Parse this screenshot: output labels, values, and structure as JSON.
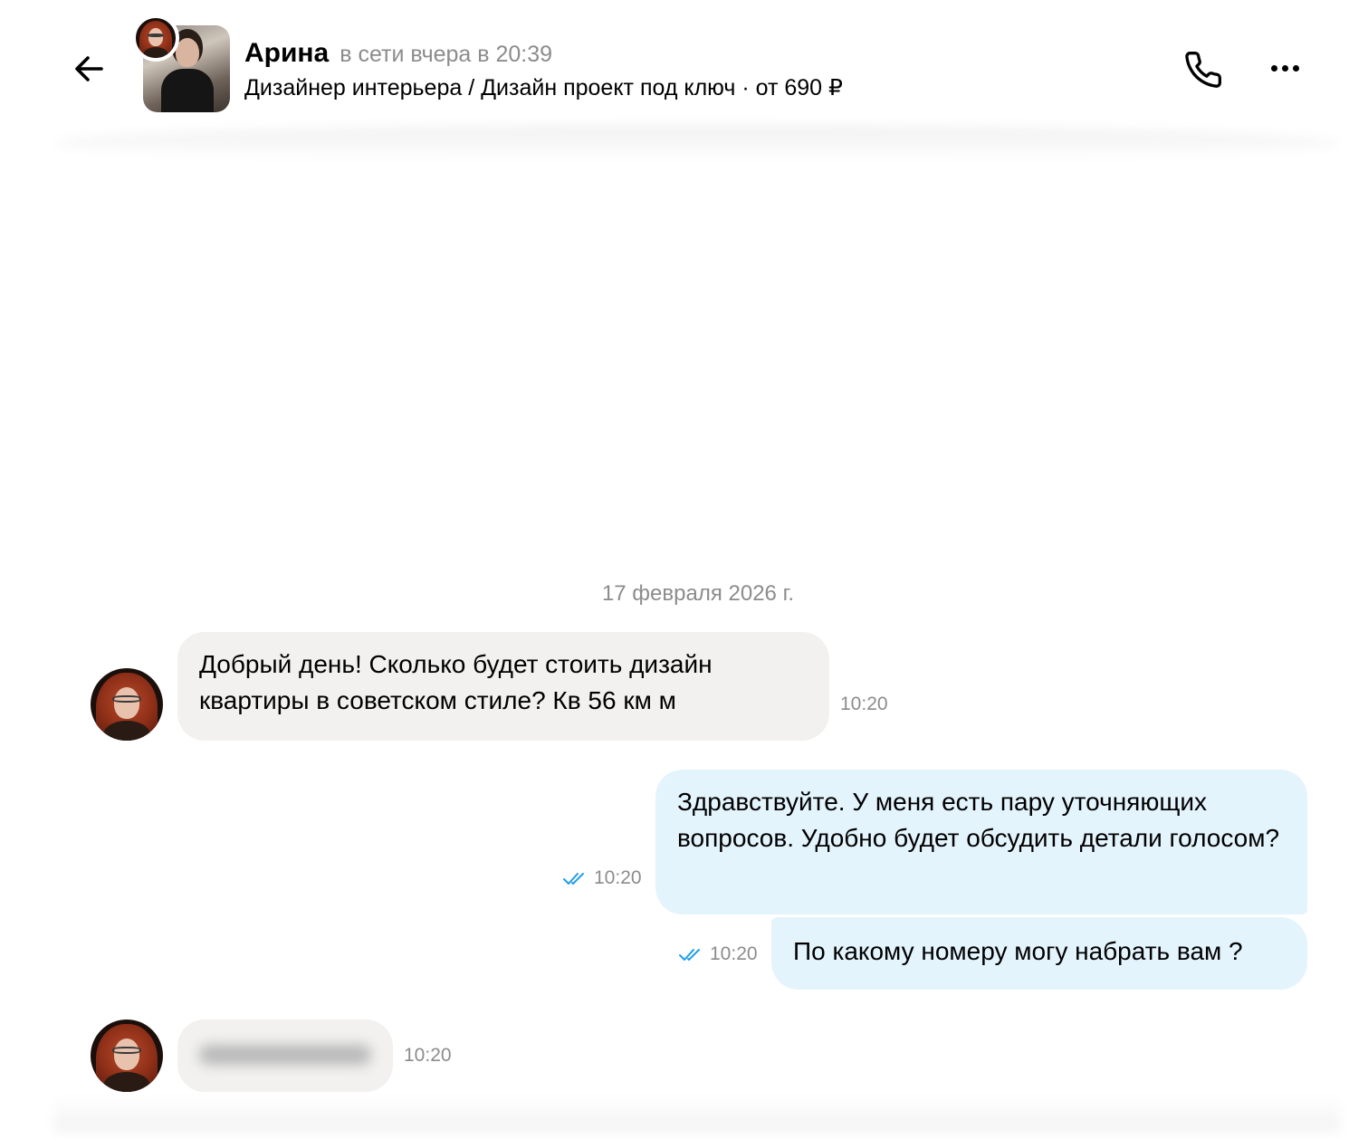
{
  "header": {
    "contact_name": "Арина",
    "contact_status": "в сети вчера в 20:39",
    "listing_title": "Дизайнер интерьера / Дизайн проект под ключ · от 690 ₽",
    "icons": {
      "back": "arrow-left-icon",
      "call": "phone-icon",
      "more": "more-dots-icon"
    }
  },
  "chat": {
    "date_separator": "17 февраля 2026 г.",
    "messages": [
      {
        "direction": "incoming",
        "text": "Добрый день! Сколько будет стоить дизайн квартиры в советском стиле? Кв 56 км м",
        "time": "10:20"
      },
      {
        "direction": "outgoing",
        "text": "Здравствуйте. У меня есть пару уточняющих вопросов. Удобно будет обсудить детали голосом?",
        "time": "10:20",
        "status": "read"
      },
      {
        "direction": "outgoing",
        "text": "По какому номеру могу набрать вам ?",
        "time": "10:20",
        "status": "read"
      },
      {
        "direction": "incoming",
        "text": "",
        "time": "10:20",
        "blurred": true
      }
    ]
  },
  "colors": {
    "incoming_bubble": "#f2f1f0",
    "outgoing_bubble": "#e4f4fd",
    "read_check": "#1e9ee8",
    "muted_text": "#8c8c8c"
  }
}
